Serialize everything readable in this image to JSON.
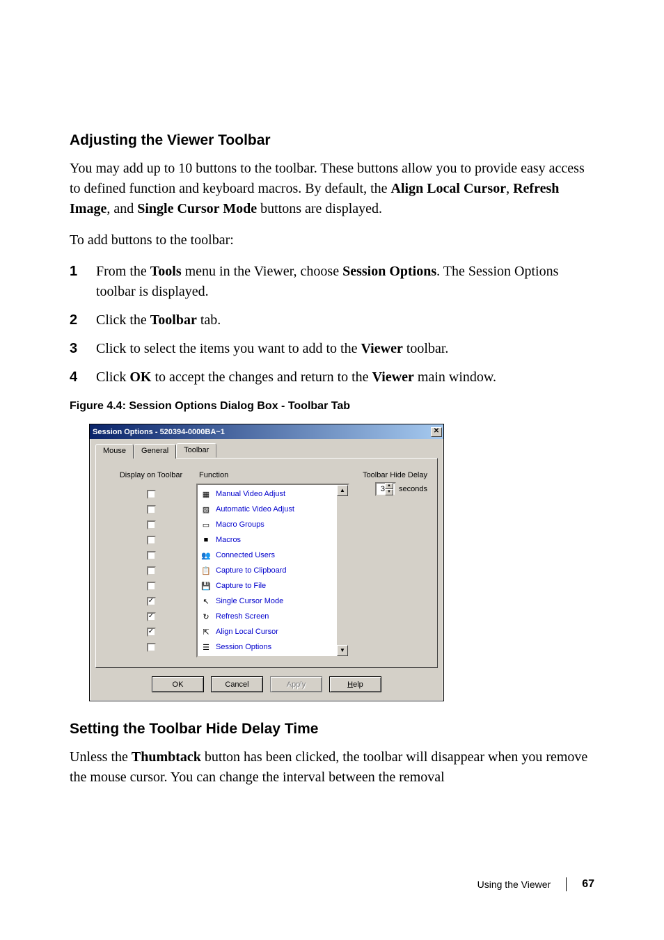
{
  "headings": {
    "h1": "Adjusting the Viewer Toolbar",
    "h2": "Setting the Toolbar Hide Delay Time"
  },
  "para1": {
    "pre": "You may add up to 10 buttons to the toolbar. These buttons allow you to provide easy access to defined function and keyboard macros. By default, the ",
    "b1": "Align Local Cursor",
    "sep1": ", ",
    "b2": "Refresh Image",
    "sep2": ", and ",
    "b3": "Single Cursor Mode",
    "post": " buttons are displayed."
  },
  "para2": "To add buttons to the toolbar:",
  "steps": [
    {
      "n": "1",
      "pre": "From the ",
      "b1": "Tools",
      "mid": " menu in the Viewer, choose ",
      "b2": "Session Options",
      "post": ". The Session Options toolbar is displayed."
    },
    {
      "n": "2",
      "pre": "Click the ",
      "b1": "Toolbar",
      "mid": "",
      "b2": "",
      "post": " tab."
    },
    {
      "n": "3",
      "pre": "Click to select the items you want to add to the ",
      "b1": "Viewer",
      "mid": "",
      "b2": "",
      "post": " toolbar."
    },
    {
      "n": "4",
      "pre": "Click ",
      "b1": "OK",
      "mid": " to accept the changes and return to the ",
      "b2": "Viewer",
      "post": " main window."
    }
  ],
  "figcap": "Figure 4.4: Session Options Dialog Box - Toolbar Tab",
  "dialog": {
    "title": "Session Options - 520394-0000BA~1",
    "tabs": [
      "Mouse",
      "General",
      "Toolbar"
    ],
    "cols": {
      "display": "Display on Toolbar",
      "func": "Function"
    },
    "rows": [
      {
        "checked": false,
        "label": "Manual Video Adjust"
      },
      {
        "checked": false,
        "label": "Automatic Video Adjust"
      },
      {
        "checked": false,
        "label": "Macro Groups"
      },
      {
        "checked": false,
        "label": "Macros"
      },
      {
        "checked": false,
        "label": "Connected Users"
      },
      {
        "checked": false,
        "label": "Capture to Clipboard"
      },
      {
        "checked": false,
        "label": "Capture to File"
      },
      {
        "checked": true,
        "label": "Single Cursor Mode"
      },
      {
        "checked": true,
        "label": "Refresh Screen"
      },
      {
        "checked": true,
        "label": "Align Local Cursor"
      },
      {
        "checked": false,
        "label": "Session Options"
      }
    ],
    "delay": {
      "label": "Toolbar Hide Delay",
      "value": "3",
      "unit": "seconds"
    },
    "buttons": {
      "ok": "OK",
      "cancel": "Cancel",
      "apply": "Apply",
      "help": "Help",
      "help_u": "H"
    }
  },
  "para3": {
    "pre": "Unless the ",
    "b1": "Thumbtack",
    "post": " button has been clicked, the toolbar will disappear when you remove the mouse cursor. You can change the interval between the removal"
  },
  "footer": {
    "section": "Using the Viewer",
    "page": "67"
  }
}
